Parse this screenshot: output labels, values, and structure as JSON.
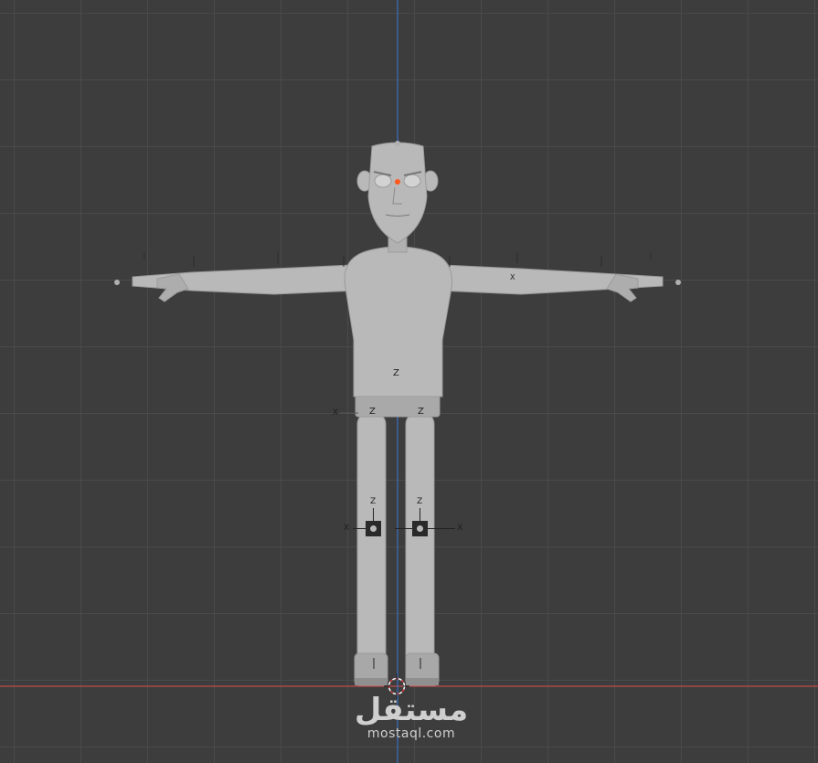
{
  "viewport": {
    "grid_color": "#4a4a4a",
    "background_color": "#3d3d3d",
    "x_axis_color": "#c44a4a",
    "z_axis_color": "#3b6fc2"
  },
  "model": {
    "body_color": "#b9b9b9",
    "shadow_color": "#8f8f8f",
    "origin_dot_color": "#ff5a1e"
  },
  "gizmos": {
    "torso_z": "Z",
    "hip_left_z": "Z",
    "hip_right_z": "Z",
    "hip_x": "X",
    "knee_left_z": "Z",
    "knee_right_z": "Z",
    "knee_left_x": "X",
    "knee_right_x": "X",
    "wrist_x": "X"
  },
  "watermark": {
    "logo_text": "مستقل",
    "url": "mostaql.com"
  },
  "icons": {
    "cursor": "3d-cursor-icon",
    "knee_control": "bone-control-square-icon"
  }
}
